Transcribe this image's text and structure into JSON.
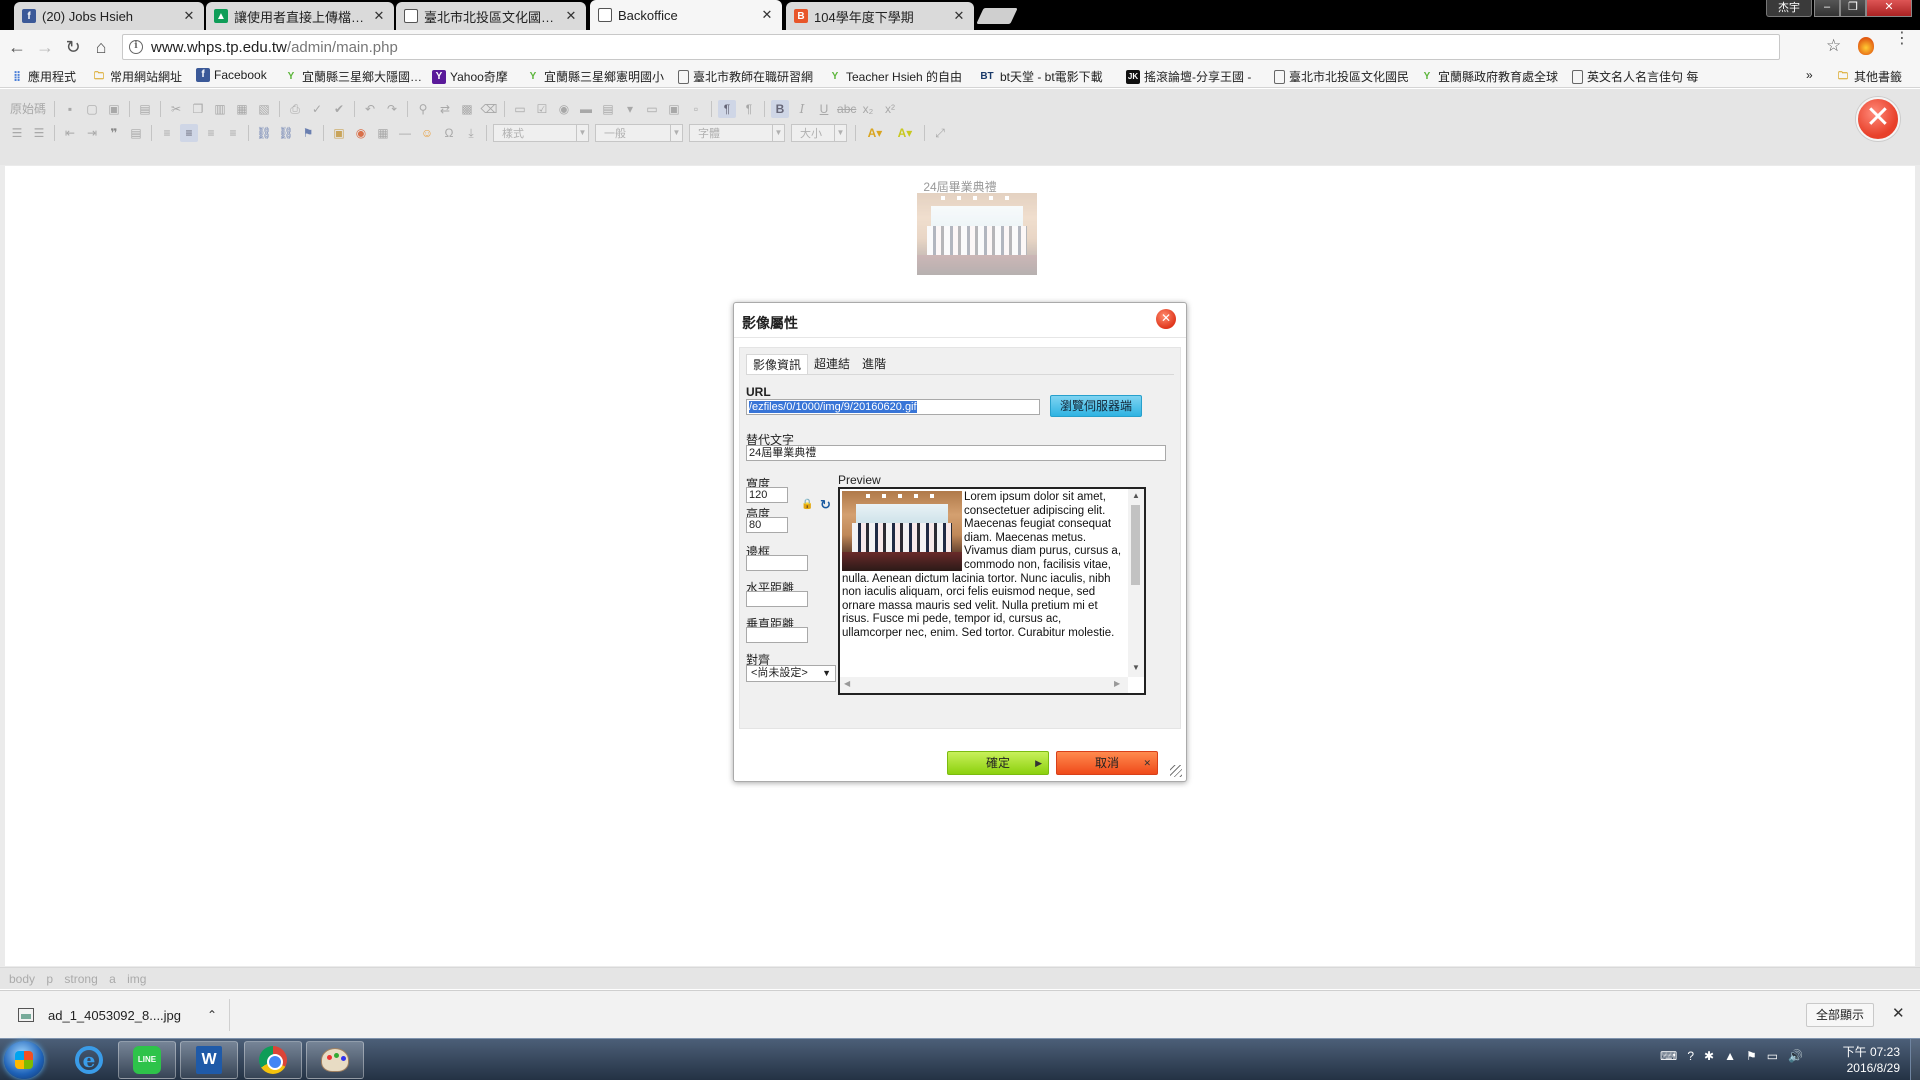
{
  "tabs": [
    {
      "title": "(20) Jobs Hsieh",
      "icon": "facebook-icon",
      "color": "#3b5998",
      "glyph": "f"
    },
    {
      "title": "讓使用者直接上傳檔案到",
      "icon": "drive-icon",
      "color": "#0f9d58",
      "glyph": "▲"
    },
    {
      "title": "臺北市北投區文化國民小",
      "icon": "page-icon",
      "color": "#ffffff",
      "glyph": ""
    },
    {
      "title": "Backoffice",
      "icon": "page-icon",
      "color": "#ffffff",
      "glyph": ""
    },
    {
      "title": "104學年度下學期",
      "icon": "blogger-icon",
      "color": "#e8562a",
      "glyph": "B"
    }
  ],
  "window": {
    "user": "杰宇"
  },
  "address": {
    "host": "www.whps.tp.edu.tw",
    "path": "/admin/main.php"
  },
  "bookmarks": [
    {
      "label": "應用程式",
      "icon": "apps-icon",
      "color": "#4a7fd8",
      "glyph": "⋮⋮"
    },
    {
      "label": "常用網站網址",
      "icon": "folder-icon",
      "color": "#e8b83a",
      "glyph": "▬"
    },
    {
      "label": "Facebook",
      "icon": "facebook-icon",
      "color": "#3b5998",
      "glyph": "f"
    },
    {
      "label": "宜蘭縣三星鄉大隱國民小",
      "icon": "sprout-icon",
      "color": "#5bb53a",
      "glyph": "Y"
    },
    {
      "label": "Yahoo奇摩",
      "icon": "yahoo-icon",
      "color": "#5a1a9a",
      "glyph": "Y"
    },
    {
      "label": "宜蘭縣三星鄉憲明國小",
      "icon": "sprout-icon",
      "color": "#5bb53a",
      "glyph": "Y"
    },
    {
      "label": "臺北市教師在職研習網",
      "icon": "page-icon",
      "color": "#ffffff",
      "glyph": ""
    },
    {
      "label": "Teacher Hsieh 的自由",
      "icon": "sprout-icon",
      "color": "#5bb53a",
      "glyph": "Y"
    },
    {
      "label": "bt天堂 - bt電影下載",
      "icon": "bt-icon",
      "color": "#1a3a6a",
      "glyph": "BT"
    },
    {
      "label": "搖滾論壇-分享王國 -",
      "icon": "jk-icon",
      "color": "#111111",
      "glyph": "JK"
    },
    {
      "label": "臺北市北投區文化國民",
      "icon": "page-icon",
      "color": "#ffffff",
      "glyph": ""
    },
    {
      "label": "宜蘭縣政府教育處全球",
      "icon": "sprout-icon",
      "color": "#5bb53a",
      "glyph": "Y"
    },
    {
      "label": "英文名人名言佳句 每",
      "icon": "page-icon",
      "color": "#ffffff",
      "glyph": ""
    }
  ],
  "bookmarks_more": "»",
  "bookmarks_other": "其他書籤",
  "toolbar": {
    "source_label": "原始碼",
    "format_combo": "樣式",
    "paragraph_combo": "一般",
    "font_combo": "字體",
    "size_combo": "大小"
  },
  "page": {
    "image_caption": "24屆畢業典禮"
  },
  "dialog": {
    "title": "影像屬性",
    "tabs": [
      "影像資訊",
      "超連結",
      "進階"
    ],
    "url_label": "URL",
    "url_value": "/ezfiles/0/1000/img/9/20160620.gif",
    "browse_label": "瀏覽伺服器端",
    "alt_label": "替代文字",
    "alt_value": "24屆畢業典禮",
    "width_label": "寬度",
    "width_value": "120",
    "height_label": "高度",
    "height_value": "80",
    "border_label": "邊框",
    "hspace_label": "水平距離",
    "vspace_label": "垂直距離",
    "align_label": "對齊",
    "align_value": "<尚未設定>",
    "preview_label": "Preview",
    "preview_text": "Lorem ipsum dolor sit amet, consectetuer adipiscing elit. Maecenas feugiat consequat diam. Maecenas metus. Vivamus diam purus, cursus a, commodo non, facilisis vitae, nulla. Aenean dictum lacinia tortor. Nunc iaculis, nibh non iaculis aliquam, orci felis euismod neque, sed ornare massa mauris sed velit. Nulla pretium mi et risus. Fusce mi pede, tempor id, cursus ac, ullamcorper nec, enim. Sed tortor. Curabitur molestie.",
    "ok_label": "確定",
    "cancel_label": "取消"
  },
  "pathbar": [
    "body",
    "p",
    "strong",
    "a",
    "img"
  ],
  "download": {
    "filename": "ad_1_4053092_8....jpg",
    "show_all": "全部顯示"
  },
  "taskbar": {
    "apps": [
      "internet-explorer",
      "line",
      "word",
      "chrome",
      "paint"
    ],
    "clock_time": "下午 07:23",
    "clock_date": "2016/8/29"
  }
}
